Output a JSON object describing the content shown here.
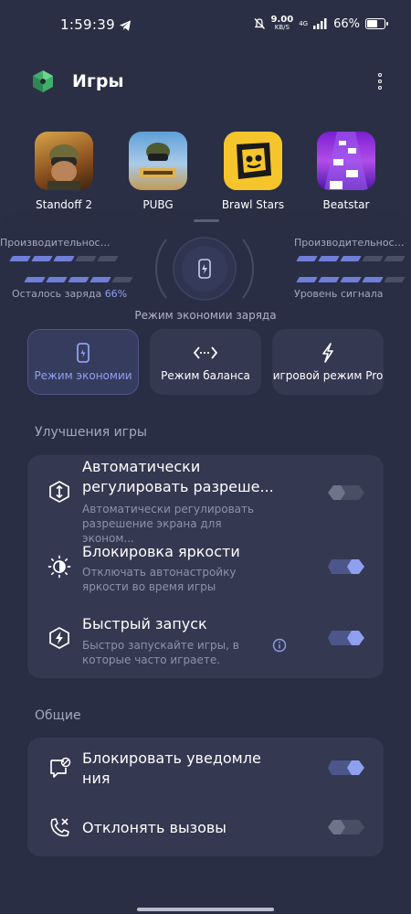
{
  "status_bar": {
    "time": "1:59:39",
    "net_speed": "9.00",
    "net_speed_unit": "KB/S",
    "network": "4G",
    "battery_text": "66%",
    "battery_level": 0.66
  },
  "header": {
    "title": "Игры"
  },
  "games": [
    {
      "name": "Standoff 2"
    },
    {
      "name": "PUBG"
    },
    {
      "name": "Brawl Stars"
    },
    {
      "name": "Beatstar"
    }
  ],
  "dashboard": {
    "perf_left": "Производительность ...",
    "perf_right": "Производительность г...",
    "charge_label": "Осталось заряда",
    "charge_value": "66%",
    "signal_label": "Уровень сигнала",
    "mode_caption": "Режим экономии заряда",
    "perf_left_level": 3,
    "perf_right_level": 3,
    "charge_level": 4,
    "signal_level": 4
  },
  "modes": [
    {
      "label": "Режим экономии",
      "active": true
    },
    {
      "label": "Режим баланса",
      "active": false
    },
    {
      "label": "игровой режим Pro",
      "active": false
    }
  ],
  "enhancements": {
    "title": "Улучшения игры",
    "items": [
      {
        "title_line1": "Автоматически",
        "title_line2": "регулировать разреше...",
        "subtitle_line1": "Автоматически регулировать",
        "subtitle_line2": "разрешение экрана для эконом...",
        "enabled": false
      },
      {
        "title": "Блокировка яркости",
        "subtitle_line1": "Отключать автонастройку",
        "subtitle_line2": "яркости во время игры",
        "enabled": true
      },
      {
        "title": "Быстрый запуск",
        "subtitle_line1": "Быстро запускайте игры, в",
        "subtitle_line2": "которые часто играете.",
        "enabled": true
      }
    ]
  },
  "general": {
    "title": "Общие",
    "items": [
      {
        "title_line1": "Блокировать уведомле",
        "title_line2": "ния",
        "enabled": true
      },
      {
        "title": "Отклонять вызовы",
        "enabled": false
      }
    ]
  },
  "colors": {
    "accent": "#8fa0ef",
    "background": "#2b2f45",
    "card": "#343850"
  }
}
